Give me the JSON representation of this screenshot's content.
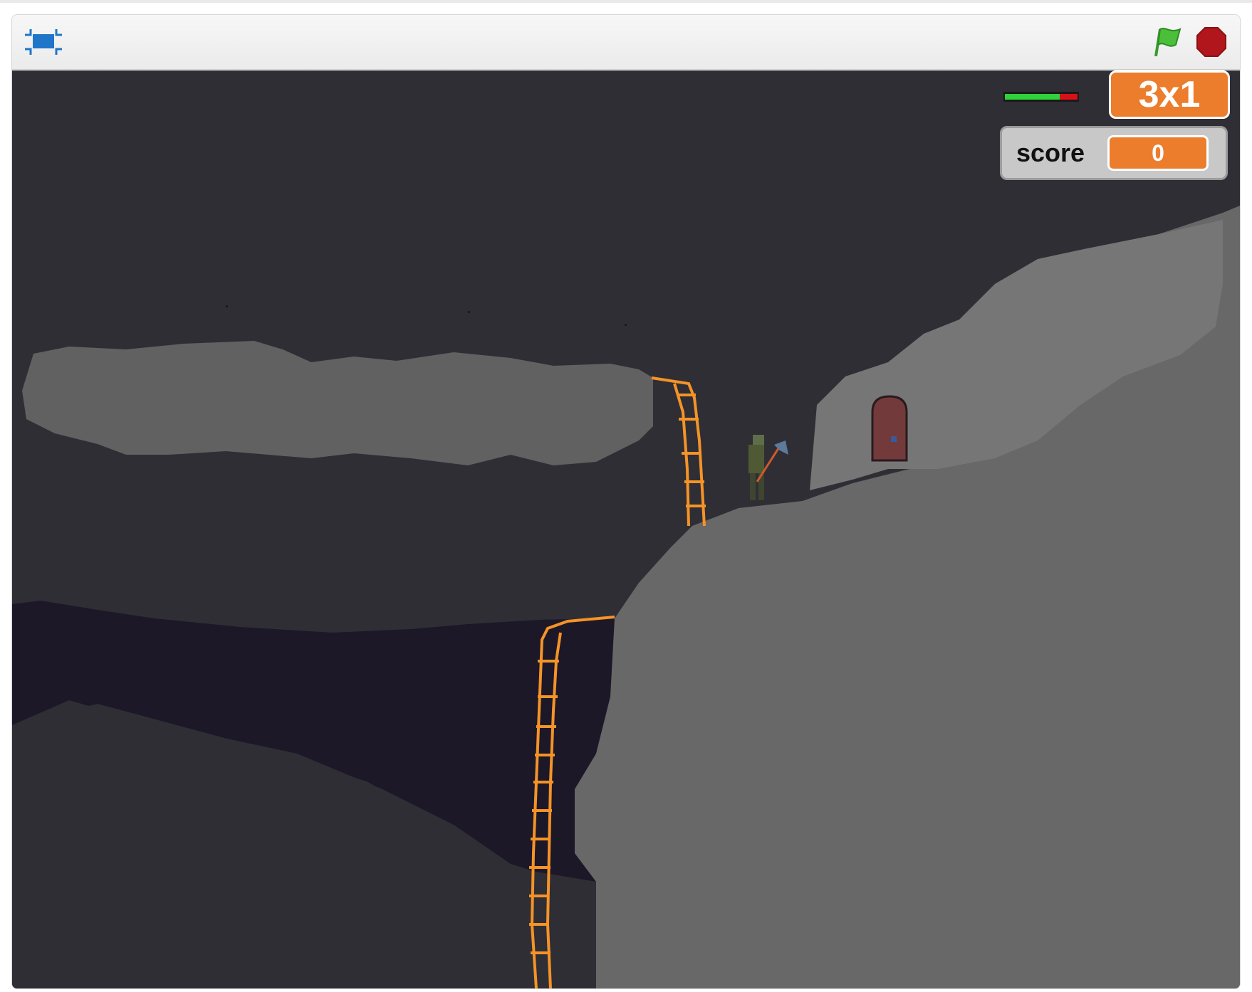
{
  "player": {
    "controls": {
      "fullscreen_icon": "fullscreen-icon",
      "flag_icon": "green-flag-icon",
      "stop_icon": "stop-sign-icon"
    }
  },
  "hud": {
    "health_fraction": 0.75,
    "health_color": "#2fd23a",
    "damage_color": "#d8101a",
    "level_label": "3x1",
    "score_label": "score",
    "score_value": "0"
  },
  "colors": {
    "sky": "#2f2e35",
    "cloud": "#616161",
    "rock": "#686868",
    "chasm": "#1c1828",
    "accent": "#ec7d2d",
    "ladder": "#f59327",
    "door": "#723a3a"
  }
}
